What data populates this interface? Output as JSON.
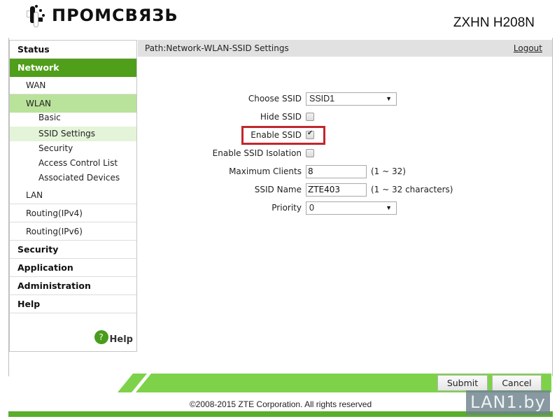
{
  "header": {
    "brand": "ПРОМСВЯЗЬ",
    "model": "ZXHN H208N"
  },
  "colors": {
    "accent_dark": "#4f9f1a",
    "accent_light": "#b9e29b",
    "accent_lightest": "#e4f4d8",
    "bar_green": "#7ed24a",
    "highlight_red": "#c1272d"
  },
  "sidebar": {
    "items": [
      {
        "label": "Status",
        "level": 1
      },
      {
        "label": "Network",
        "level": 1,
        "active": true
      },
      {
        "label": "WAN",
        "level": 2
      },
      {
        "label": "WLAN",
        "level": 2,
        "active": true
      },
      {
        "label": "Basic",
        "level": 3
      },
      {
        "label": "SSID Settings",
        "level": 3,
        "active": true
      },
      {
        "label": "Security",
        "level": 3
      },
      {
        "label": "Access Control List",
        "level": 3
      },
      {
        "label": "Associated Devices",
        "level": 3
      },
      {
        "label": "LAN",
        "level": 2
      },
      {
        "label": "Routing(IPv4)",
        "level": 2
      },
      {
        "label": "Routing(IPv6)",
        "level": 2
      },
      {
        "label": "Security",
        "level": 1
      },
      {
        "label": "Application",
        "level": 1
      },
      {
        "label": "Administration",
        "level": 1
      },
      {
        "label": "Help",
        "level": 1
      }
    ],
    "help_link": "Help",
    "help_icon": "?"
  },
  "pathbar": {
    "path": "Path:Network-WLAN-SSID Settings",
    "logout": "Logout"
  },
  "form": {
    "choose_ssid": {
      "label": "Choose SSID",
      "value": "SSID1"
    },
    "hide_ssid": {
      "label": "Hide SSID",
      "checked": false
    },
    "enable_ssid": {
      "label": "Enable SSID",
      "checked": true
    },
    "ssid_isolation": {
      "label": "Enable SSID Isolation",
      "checked": false
    },
    "max_clients": {
      "label": "Maximum Clients",
      "value": "8",
      "hint": "(1 ~ 32)"
    },
    "ssid_name": {
      "label": "SSID Name",
      "value": "ZTE403",
      "hint": "(1 ~ 32 characters)"
    },
    "priority": {
      "label": "Priority",
      "value": "0"
    },
    "select_arrow": "▼"
  },
  "actions": {
    "submit": "Submit",
    "cancel": "Cancel"
  },
  "footer": {
    "copyright": "©2008-2015 ZTE Corporation. All rights reserved"
  },
  "watermark": "LAN1.by"
}
